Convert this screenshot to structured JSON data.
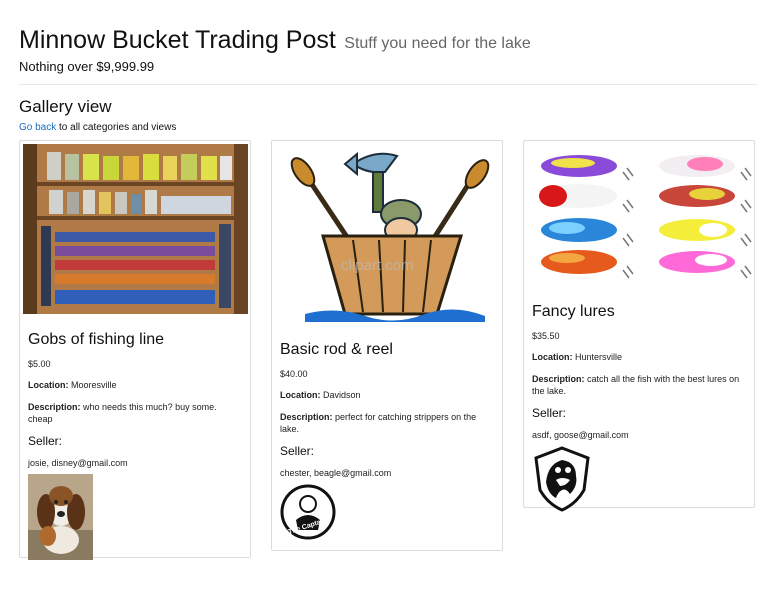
{
  "header": {
    "title": "Minnow Bucket Trading Post",
    "tagline": "Stuff you need for the lake",
    "price_cap": "Nothing over $9,999.99"
  },
  "gallery": {
    "heading": "Gallery view",
    "back_link": "Go back",
    "back_suffix": " to all categories and views"
  },
  "labels": {
    "location": "Location:",
    "description": "Description:",
    "seller": "Seller:"
  },
  "items": [
    {
      "title": "Gobs of fishing line",
      "price": "$5.00",
      "location": "Mooresville",
      "description": "who needs this much? buy some. cheap",
      "seller": "josie, disney@gmail.com",
      "image": "fishing-line-display-photo",
      "avatar": "beagle-photo"
    },
    {
      "title": "Basic rod & reel",
      "price": "$40.00",
      "location": "Davidson",
      "description": "perfect for catching strippers on the lake.",
      "seller": "chester, beagle@gmail.com",
      "image": "fisherman-in-boat-clipart",
      "watermark": "clipart.com",
      "avatar": "the-captain-logo",
      "avatar_text": "The Captain"
    },
    {
      "title": "Fancy lures",
      "price": "$35.50",
      "location": "Huntersville",
      "description": "catch all the fish with the best lures on the lake.",
      "seller": "asdf, goose@gmail.com",
      "image": "fishing-lures-photo",
      "avatar": "goose-head-shield-logo"
    }
  ]
}
